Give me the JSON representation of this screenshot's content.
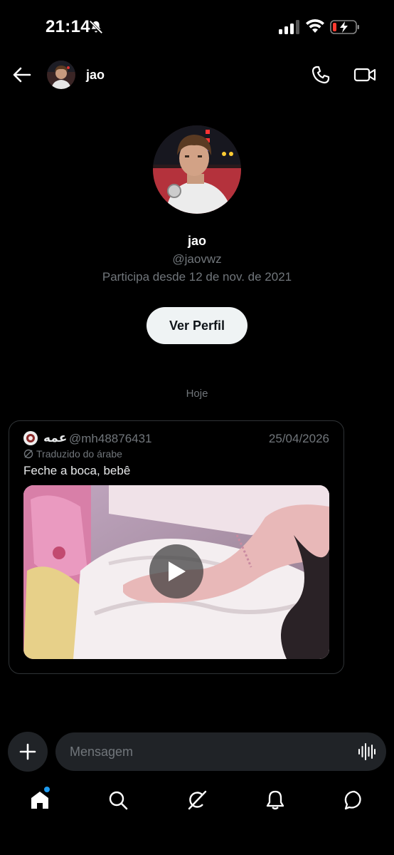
{
  "status_bar": {
    "time": "21:14"
  },
  "header": {
    "name": "jao"
  },
  "profile": {
    "name": "jao",
    "handle": "@jaovwz",
    "joined": "Participa desde 12 de nov. de 2021",
    "view_profile_label": "Ver Perfil"
  },
  "date_separator": "Hoje",
  "tweet": {
    "author": "عمه",
    "handle": "@mh48876431",
    "date": "25/04/2026",
    "translated_label": "Traduzido do árabe",
    "text": "Feche a boca, bebê"
  },
  "composer": {
    "placeholder": "Mensagem"
  },
  "colors": {
    "accent": "#1d9bf0",
    "background": "#000000",
    "muted": "#71767b"
  },
  "nav": {
    "items": [
      "home-icon",
      "search-icon",
      "grok-icon",
      "notifications-icon",
      "messages-icon"
    ],
    "home_has_notification_dot": true
  }
}
